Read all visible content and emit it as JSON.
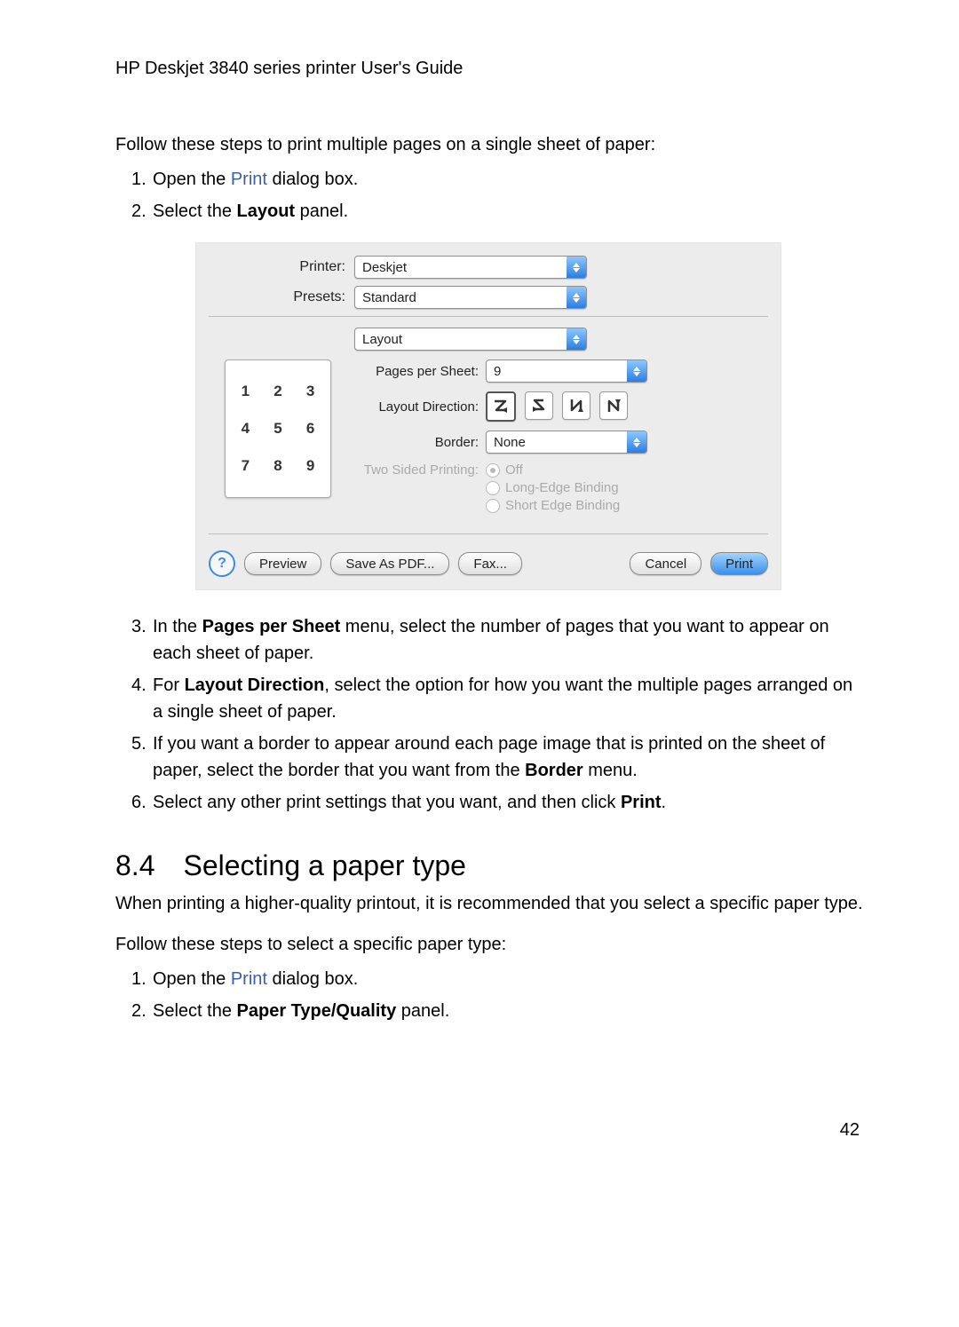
{
  "header_title": "HP Deskjet 3840 series printer User's Guide",
  "intro_para": "Follow these steps to print multiple pages on a single sheet of paper:",
  "step1_prefix": "Open the ",
  "step1_link": "Print",
  "step1_suffix": " dialog box.",
  "step2_prefix": "Select the ",
  "step2_bold": "Layout",
  "step2_suffix": " panel.",
  "step3_prefix": "In the ",
  "step3_bold": "Pages per Sheet",
  "step3_suffix": " menu, select the number of pages that you want to appear on each sheet of paper.",
  "step4_prefix": "For ",
  "step4_bold": "Layout Direction",
  "step4_suffix": ", select the option for how you want the multiple pages arranged on a single sheet of paper.",
  "step5_prefix": "If you want a border to appear around each page image that is printed on the sheet of paper, select the border that you want from the ",
  "step5_bold": "Border",
  "step5_suffix": " menu.",
  "step6_prefix": "Select any other print settings that you want, and then click ",
  "step6_bold": "Print",
  "step6_suffix": ".",
  "section_heading": "8.4 Selecting a paper type",
  "section_para": "When printing a higher-quality printout, it is recommended that you select a specific paper type.",
  "section_para2": "Follow these steps to select a specific paper type:",
  "b_step1_prefix": "Open the ",
  "b_step1_link": "Print",
  "b_step1_suffix": " dialog box.",
  "b_step2_prefix": "Select the ",
  "b_step2_bold": "Paper Type/Quality",
  "b_step2_suffix": " panel.",
  "page_number": "42",
  "dialog": {
    "printer_label": "Printer:",
    "printer_value": "Deskjet",
    "presets_label": "Presets:",
    "presets_value": "Standard",
    "panel_value": "Layout",
    "pps_label": "Pages per Sheet:",
    "pps_value": "9",
    "layout_dir_label": "Layout Direction:",
    "border_label": "Border:",
    "border_value": "None",
    "two_sided_label": "Two Sided Printing:",
    "ts_off": "Off",
    "ts_long": "Long-Edge Binding",
    "ts_short": "Short Edge Binding",
    "preview_cells": [
      "1",
      "2",
      "3",
      "4",
      "5",
      "6",
      "7",
      "8",
      "9"
    ],
    "help": "?",
    "btn_preview": "Preview",
    "btn_save_pdf": "Save As PDF...",
    "btn_fax": "Fax...",
    "btn_cancel": "Cancel",
    "btn_print": "Print"
  }
}
